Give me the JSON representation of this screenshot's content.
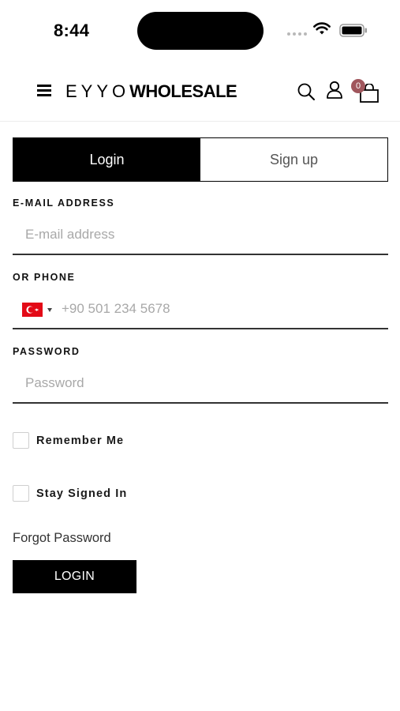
{
  "status_bar": {
    "time": "8:44"
  },
  "header": {
    "brand_light": "EYYO",
    "brand_bold": "WHOLESALE",
    "cart_count": "0",
    "icons": [
      "menu-icon",
      "search-icon",
      "user-icon",
      "shopping-bag-icon"
    ]
  },
  "tabs": {
    "login": "Login",
    "signup": "Sign up",
    "active": "login"
  },
  "form": {
    "email_label": "E-MAIL ADDRESS",
    "email_placeholder": "E-mail address",
    "email_value": "",
    "phone_label": "OR PHONE",
    "phone_country_flag": "turkey-flag-icon",
    "phone_placeholder": "+90 501 234 5678",
    "phone_value": "",
    "password_label": "PASSWORD",
    "password_placeholder": "Password",
    "password_value": "",
    "remember_me": "Remember Me",
    "remember_me_checked": false,
    "stay_signed_in": "Stay Signed In",
    "stay_signed_in_checked": false,
    "forgot_password": "Forgot Password",
    "login_button": "LOGIN"
  },
  "colors": {
    "primary": "#000000",
    "badge": "#a0565c",
    "flag": "#e30a17"
  }
}
